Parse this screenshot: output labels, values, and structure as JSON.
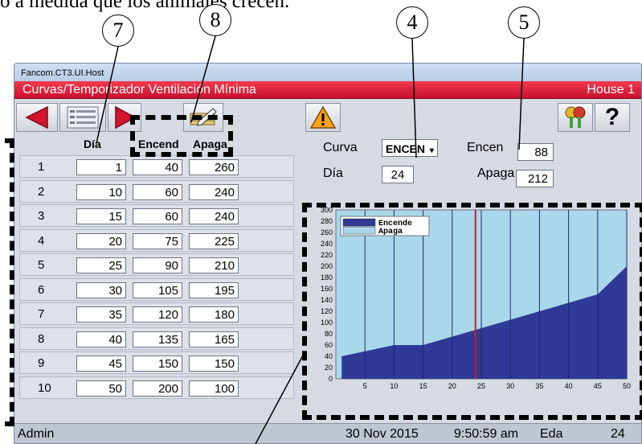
{
  "document": {
    "caption_fragment": "o a medida que los animales crecen.",
    "callouts": [
      "7",
      "8",
      "4",
      "5"
    ]
  },
  "window": {
    "host_title": "Fancom.CT3.UI.Host",
    "title": "Curvas/Temporizador Ventilación Mínima",
    "house": "House 1",
    "accent_red": "#d3142b"
  },
  "toolbar": {
    "buttons": [
      {
        "name": "back-arrow-icon"
      },
      {
        "name": "list-icon"
      },
      {
        "name": "forward-arrow-icon"
      },
      {
        "name": "edit-table-icon"
      },
      {
        "name": "warning-icon"
      },
      {
        "name": "keys-icon"
      },
      {
        "name": "help-icon",
        "label": "?"
      }
    ]
  },
  "table": {
    "headers": [
      "Día",
      "Encend",
      "Apaga"
    ],
    "rows": [
      {
        "n": "1",
        "dia": "1",
        "encend": "40",
        "apaga": "260"
      },
      {
        "n": "2",
        "dia": "10",
        "encend": "60",
        "apaga": "240"
      },
      {
        "n": "3",
        "dia": "15",
        "encend": "60",
        "apaga": "240"
      },
      {
        "n": "4",
        "dia": "20",
        "encend": "75",
        "apaga": "225"
      },
      {
        "n": "5",
        "dia": "25",
        "encend": "90",
        "apaga": "210"
      },
      {
        "n": "6",
        "dia": "30",
        "encend": "105",
        "apaga": "195"
      },
      {
        "n": "7",
        "dia": "35",
        "encend": "120",
        "apaga": "180"
      },
      {
        "n": "8",
        "dia": "40",
        "encend": "135",
        "apaga": "165"
      },
      {
        "n": "9",
        "dia": "45",
        "encend": "150",
        "apaga": "150"
      },
      {
        "n": "10",
        "dia": "50",
        "encend": "200",
        "apaga": "100"
      }
    ]
  },
  "controls": {
    "curva_label": "Curva",
    "curva_value": "ENCEN",
    "dia_label": "Día",
    "dia_value": "24",
    "encen_label": "Encen",
    "encen_value": "88",
    "apaga_label": "Apaga",
    "apaga_value": "212"
  },
  "chart_data": {
    "type": "area",
    "x": [
      1,
      10,
      15,
      20,
      25,
      30,
      35,
      40,
      45,
      50
    ],
    "series": [
      {
        "name": "Encende",
        "values": [
          40,
          60,
          60,
          75,
          90,
          105,
          120,
          135,
          150,
          200
        ],
        "color": "#2e3a96"
      },
      {
        "name": "Apaga",
        "values": [
          260,
          240,
          240,
          225,
          210,
          195,
          180,
          165,
          150,
          100
        ],
        "color": "#a9d8ea"
      }
    ],
    "xticks": [
      5,
      10,
      15,
      20,
      25,
      30,
      35,
      40,
      45,
      50
    ],
    "yticks": [
      0,
      20,
      40,
      60,
      80,
      100,
      120,
      140,
      160,
      180,
      200,
      220,
      240,
      260,
      280,
      300
    ],
    "xlim": [
      0,
      50
    ],
    "ylim": [
      0,
      300
    ],
    "current_day": 24,
    "current_day_color": "#d3142b",
    "legend_position": "top-left",
    "grid": true
  },
  "status": {
    "user": "Admin",
    "date": "30 Nov 2015",
    "time": "9:50:59 am",
    "age_label": "Eda",
    "age_value": "24"
  }
}
